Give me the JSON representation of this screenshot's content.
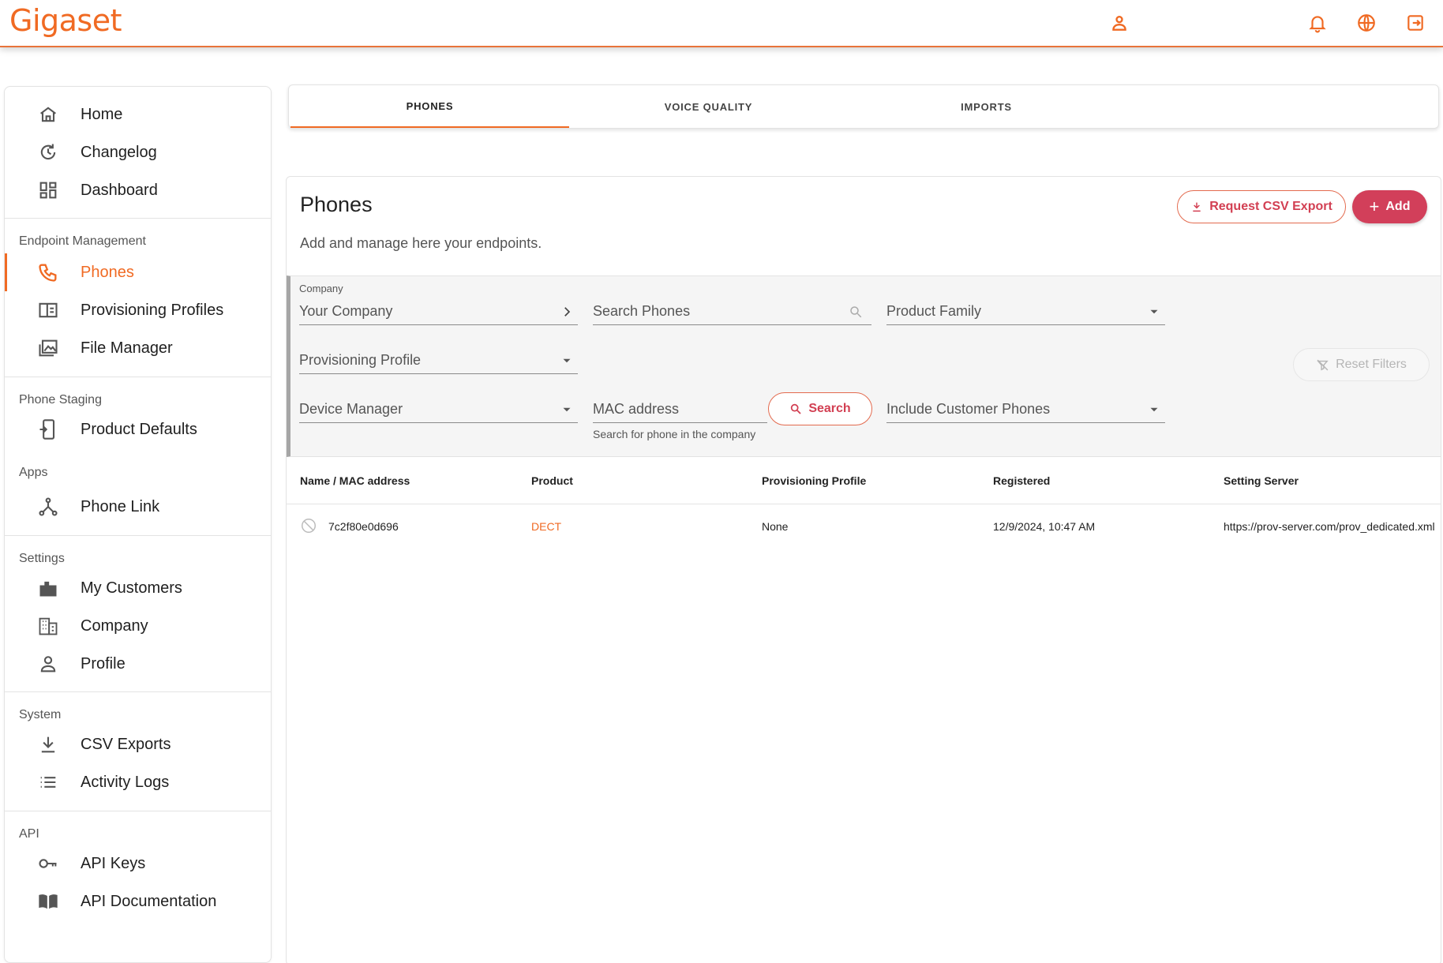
{
  "app": {
    "logo": "Gigaset"
  },
  "sidebar": {
    "top_items": [
      {
        "label": "Home",
        "icon": "home-icon"
      },
      {
        "label": "Changelog",
        "icon": "history-icon"
      },
      {
        "label": "Dashboard",
        "icon": "dashboard-icon"
      }
    ],
    "sections": [
      {
        "title": "Endpoint Management",
        "items": [
          {
            "label": "Phones",
            "icon": "phone-icon",
            "active": true
          },
          {
            "label": "Provisioning Profiles",
            "icon": "profile-panel-icon"
          },
          {
            "label": "File Manager",
            "icon": "images-icon"
          }
        ]
      },
      {
        "title": "Phone Staging",
        "items": [
          {
            "label": "Product Defaults",
            "icon": "device-icon"
          }
        ]
      },
      {
        "title": "Apps",
        "items": [
          {
            "label": "Phone Link",
            "icon": "connection-icon"
          }
        ]
      },
      {
        "title": "Settings",
        "items": [
          {
            "label": "My Customers",
            "icon": "city-icon"
          },
          {
            "label": "Company",
            "icon": "building-icon"
          },
          {
            "label": "Profile",
            "icon": "person-icon"
          }
        ]
      },
      {
        "title": "System",
        "items": [
          {
            "label": "CSV Exports",
            "icon": "download-icon"
          },
          {
            "label": "Activity Logs",
            "icon": "list-icon"
          }
        ]
      },
      {
        "title": "API",
        "items": [
          {
            "label": "API Keys",
            "icon": "key-icon"
          },
          {
            "label": "API Documentation",
            "icon": "book-icon"
          }
        ]
      }
    ]
  },
  "tabs": [
    {
      "label": "PHONES",
      "active": true
    },
    {
      "label": "VOICE QUALITY"
    },
    {
      "label": "IMPORTS"
    }
  ],
  "main": {
    "title": "Phones",
    "subtitle": "Add and manage here your endpoints.",
    "csv_export_label": "Request CSV Export",
    "add_label": "Add"
  },
  "filters": {
    "company_label": "Company",
    "company_value": "Your Company",
    "search_placeholder": "Search Phones",
    "product_family": "Product Family",
    "provisioning_profile": "Provisioning Profile",
    "device_manager": "Device Manager",
    "mac_placeholder": "MAC address",
    "mac_hint": "Search for phone in the company",
    "search_button": "Search",
    "include_customer_phones": "Include Customer Phones",
    "reset_filters": "Reset Filters"
  },
  "table": {
    "columns": [
      "Name / MAC address",
      "Product",
      "Provisioning Profile",
      "Registered",
      "Setting Server"
    ],
    "rows": [
      {
        "name": "7c2f80e0d696",
        "product": "DECT",
        "profile": "None",
        "registered": "12/9/2024, 10:47 AM",
        "server": "https://prov-server.com/prov_dedicated.xml"
      }
    ]
  },
  "colors": {
    "accent": "#f06a23",
    "primary_button": "#d23f5a"
  }
}
